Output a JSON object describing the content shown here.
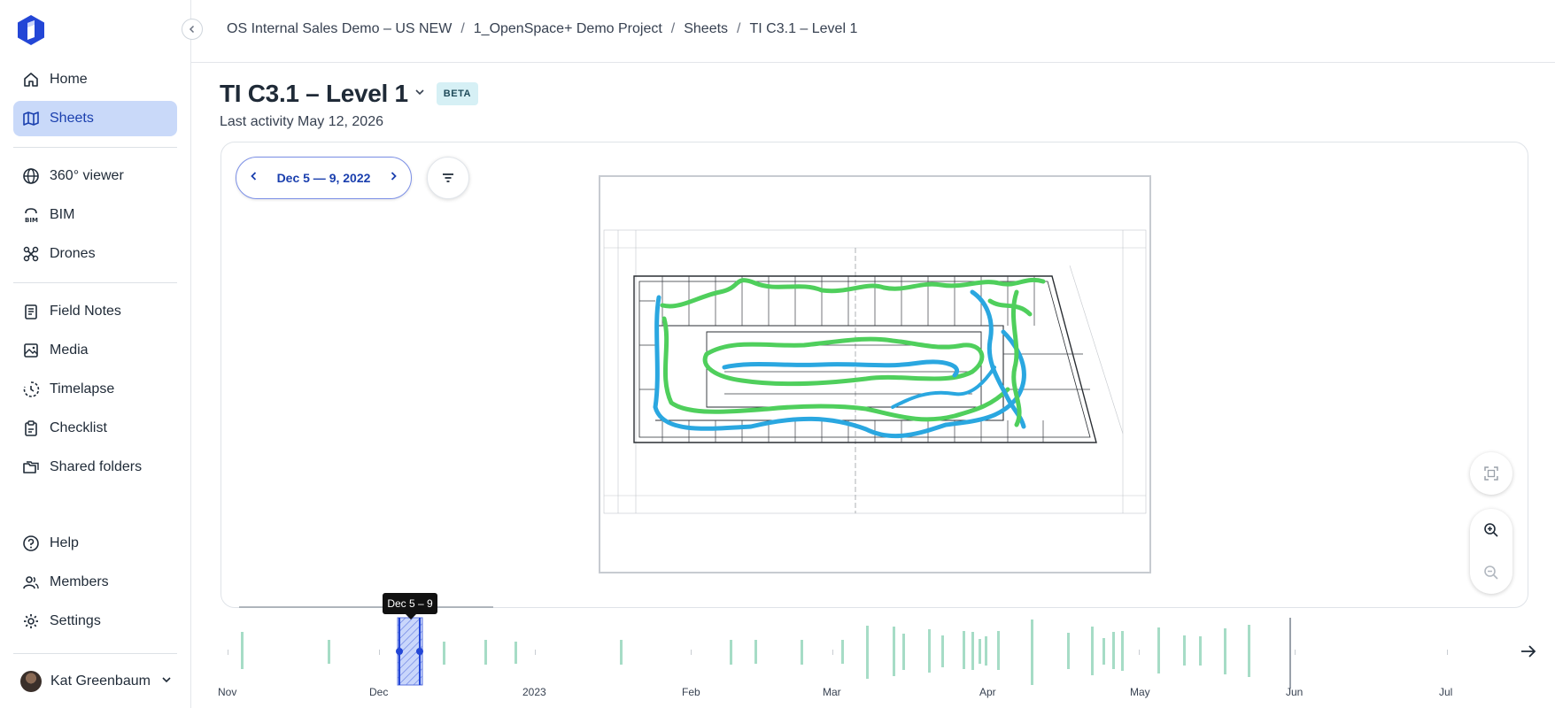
{
  "sidebar": {
    "items": [
      {
        "label": "Home",
        "icon": "home-icon"
      },
      {
        "label": "Sheets",
        "icon": "map-icon"
      },
      {
        "label": "360° viewer",
        "icon": "globe-icon"
      },
      {
        "label": "BIM",
        "icon": "bim-icon"
      },
      {
        "label": "Drones",
        "icon": "drone-icon"
      },
      {
        "label": "Field Notes",
        "icon": "notes-icon"
      },
      {
        "label": "Media",
        "icon": "image-icon"
      },
      {
        "label": "Timelapse",
        "icon": "timelapse-icon"
      },
      {
        "label": "Checklist",
        "icon": "clipboard-icon"
      },
      {
        "label": "Shared folders",
        "icon": "folder-icon"
      },
      {
        "label": "Help",
        "icon": "help-icon"
      },
      {
        "label": "Members",
        "icon": "users-icon"
      },
      {
        "label": "Settings",
        "icon": "gear-icon"
      }
    ],
    "active": "Sheets",
    "user": {
      "name": "Kat Greenbaum"
    }
  },
  "breadcrumb": {
    "items": [
      "OS Internal Sales Demo – US NEW",
      "1_OpenSpace+ Demo Project",
      "Sheets",
      "TI C3.1 – Level 1"
    ],
    "separator": "/"
  },
  "header": {
    "title": "TI C3.1 – Level 1",
    "badge": "BETA",
    "last_activity": "Last activity May 12, 2026"
  },
  "viewer": {
    "date_range": "Dec 5 — 9, 2022"
  },
  "timeline": {
    "selected_tooltip": "Dec 5 – 9",
    "months": [
      "Nov",
      "Dec",
      "2023",
      "Feb",
      "Mar",
      "Apr",
      "May",
      "Jun",
      "Jul"
    ]
  },
  "colors": {
    "accent": "#1a3fae",
    "active_bg": "#c9d9f9",
    "path_green": "#4fcf5c",
    "path_blue": "#2aa7e0",
    "timeline_bar": "#a6dcc6"
  }
}
